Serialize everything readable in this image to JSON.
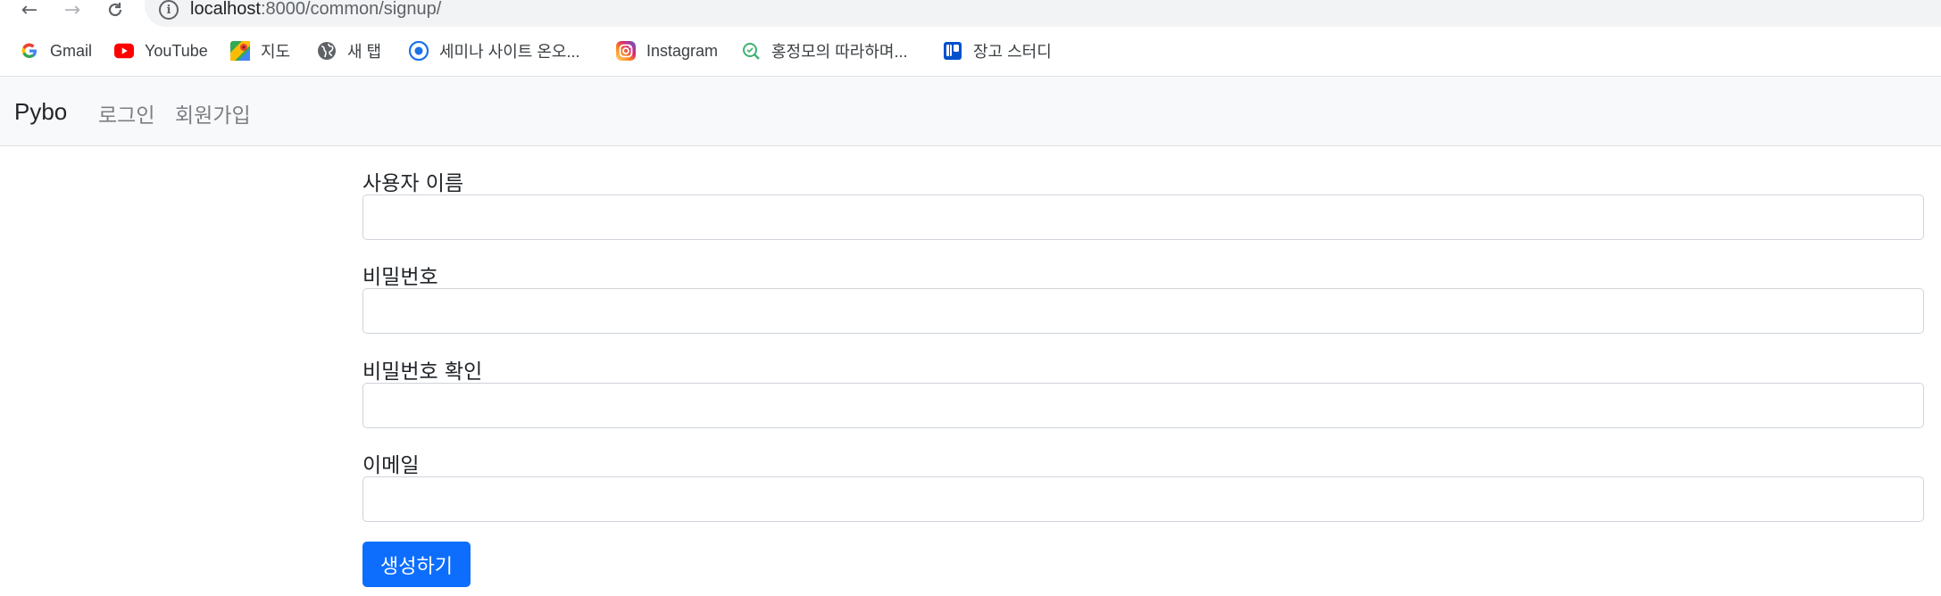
{
  "browser": {
    "url_host": "localhost",
    "url_path": ":8000/common/signup/"
  },
  "bookmarks": [
    {
      "label": "Gmail",
      "icon": "google-icon"
    },
    {
      "label": "YouTube",
      "icon": "youtube-icon"
    },
    {
      "label": "지도",
      "icon": "maps-icon"
    },
    {
      "label": "새 탭",
      "icon": "globe-icon"
    },
    {
      "label": "세미나 사이트 온오...",
      "icon": "chrome-target-icon"
    },
    {
      "label": "Instagram",
      "icon": "instagram-icon"
    },
    {
      "label": "홍정모의 따라하며...",
      "icon": "search-green-icon"
    },
    {
      "label": "장고 스터디",
      "icon": "trello-icon"
    }
  ],
  "navbar": {
    "brand": "Pybo",
    "links": [
      "로그인",
      "회원가입"
    ]
  },
  "form": {
    "fields": [
      {
        "label": "사용자 이름",
        "value": ""
      },
      {
        "label": "비밀번호",
        "value": ""
      },
      {
        "label": "비밀번호 확인",
        "value": ""
      },
      {
        "label": "이메일",
        "value": ""
      }
    ],
    "submit_label": "생성하기"
  },
  "colors": {
    "primary": "#0d6efd",
    "navbar_bg": "#f8f9fa",
    "muted_link": "#7b7f84"
  }
}
